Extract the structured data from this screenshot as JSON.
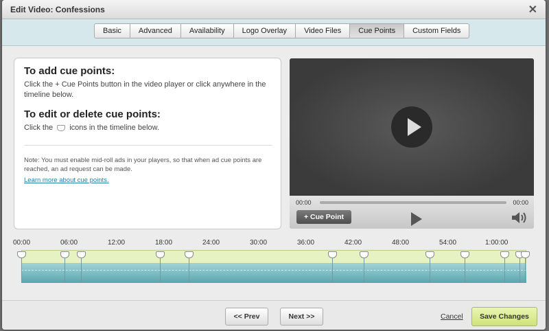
{
  "dialog": {
    "title": "Edit Video: Confessions",
    "close": "✕"
  },
  "tabs": [
    {
      "label": "Basic"
    },
    {
      "label": "Advanced"
    },
    {
      "label": "Availability"
    },
    {
      "label": "Logo Overlay"
    },
    {
      "label": "Video Files"
    },
    {
      "label": "Cue Points",
      "active": true
    },
    {
      "label": "Custom Fields"
    }
  ],
  "help": {
    "add_title": "To add cue points:",
    "add_body": "Click the + Cue Points button in the video player or click anywhere in the timeline below.",
    "edit_title": "To edit or delete cue points:",
    "edit_body_pre": "Click the",
    "edit_body_post": "icons in the timeline below.",
    "note": "Note: You must enable mid-roll ads in your players, so that when ad cue points are reached, an ad request can be made.",
    "learn_more": "Learn more about cue points."
  },
  "player": {
    "time_current": "00:00",
    "time_total": "00:00",
    "cue_point_button": "+ Cue Point"
  },
  "timeline": {
    "labels": [
      "00:00",
      "06:00",
      "12:00",
      "18:00",
      "24:00",
      "30:00",
      "36:00",
      "42:00",
      "48:00",
      "54:00",
      "1:00:00"
    ],
    "markers_minutes": [
      0,
      5.5,
      7.6,
      17.6,
      21.2,
      39.4,
      43.4,
      51.7,
      56.2,
      61.2,
      63.1,
      63.8
    ]
  },
  "footer": {
    "prev": "<< Prev",
    "next": "Next >>",
    "cancel": "Cancel",
    "save": "Save Changes"
  }
}
